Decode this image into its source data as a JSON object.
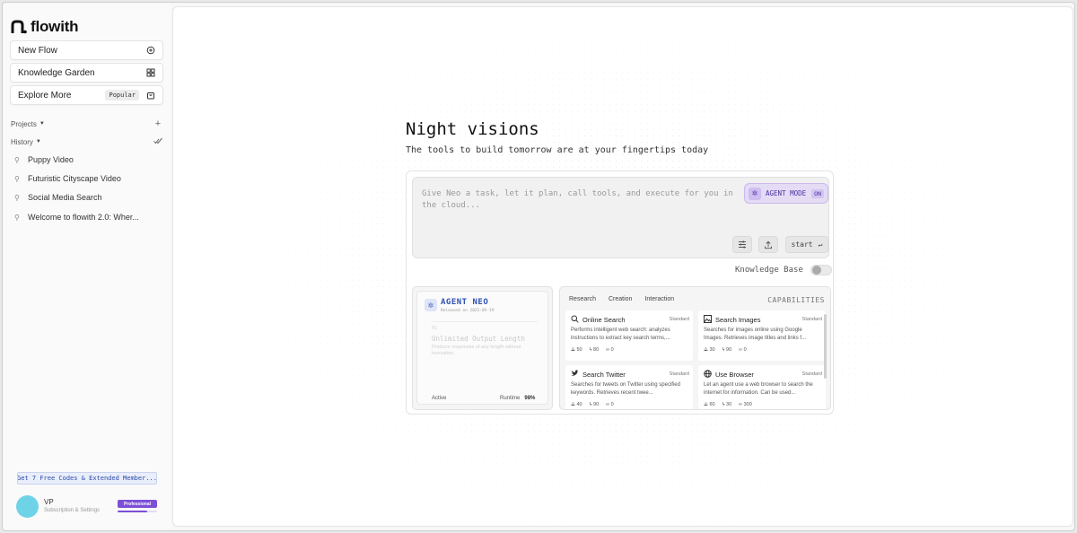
{
  "app": {
    "brand": "flowith"
  },
  "sidebar": {
    "new_flow": "New Flow",
    "knowledge_garden": "Knowledge Garden",
    "explore_more": "Explore More",
    "popular_badge": "Popular",
    "projects_label": "Projects",
    "history_label": "History",
    "history": [
      {
        "label": "Puppy Video"
      },
      {
        "label": "Futuristic Cityscape Video"
      },
      {
        "label": "Social Media Search"
      },
      {
        "label": "Welcome to flowith 2.0: Wher..."
      }
    ],
    "promo": "Get 7 Free Codes & Extended Member...",
    "user": {
      "name": "VP",
      "subtitle": "Subscription & Settings",
      "plan": "Professional",
      "plan_progress": 0.75
    }
  },
  "hero": {
    "title": "Night visions",
    "subtitle": "The tools to build tomorrow are at your fingertips today"
  },
  "composer": {
    "placeholder": "Give Neo a task, let it plan, call tools, and execute for you in the cloud...",
    "agent_mode_label": "AGENT MODE",
    "agent_mode_state": "ON",
    "start_label": "start",
    "start_hint": "↵",
    "knowledge_base_label": "Knowledge Base",
    "knowledge_base_on": false
  },
  "agent_card": {
    "name": "AGENT NEO",
    "released": "Released on 2025-05-19",
    "small": "01",
    "feature": "Unlimited Output Length",
    "feature_desc": "Produce responses of any length without truncation.",
    "status": "Active",
    "runtime_label": "Runtime",
    "runtime_value": "98%"
  },
  "capabilities": {
    "heading": "CAPABILITIES",
    "tabs": [
      "Research",
      "Creation",
      "Interaction"
    ],
    "items": [
      {
        "icon": "search-icon",
        "title": "Online Search",
        "tier": "Standard",
        "desc": "Performs intelligent web search: analyzes instructions to extract key search terms,...",
        "m1": "50",
        "m2": "80",
        "m3": "0"
      },
      {
        "icon": "image-icon",
        "title": "Search Images",
        "tier": "Standard",
        "desc": "Searches for images online using Google Images. Retrieves image titles and links f...",
        "m1": "30",
        "m2": "90",
        "m3": "0"
      },
      {
        "icon": "twitter-icon",
        "title": "Search Twitter",
        "tier": "Standard",
        "desc": "Searches for tweets on Twitter using specified keywords. Retrieves recent twee...",
        "m1": "40",
        "m2": "90",
        "m3": "0"
      },
      {
        "icon": "globe-icon",
        "title": "Use Browser",
        "tier": "Standard",
        "desc": "Let an agent use a web browser to search the internet for information. Can be used...",
        "m1": "60",
        "m2": "30",
        "m3": "300"
      }
    ]
  }
}
